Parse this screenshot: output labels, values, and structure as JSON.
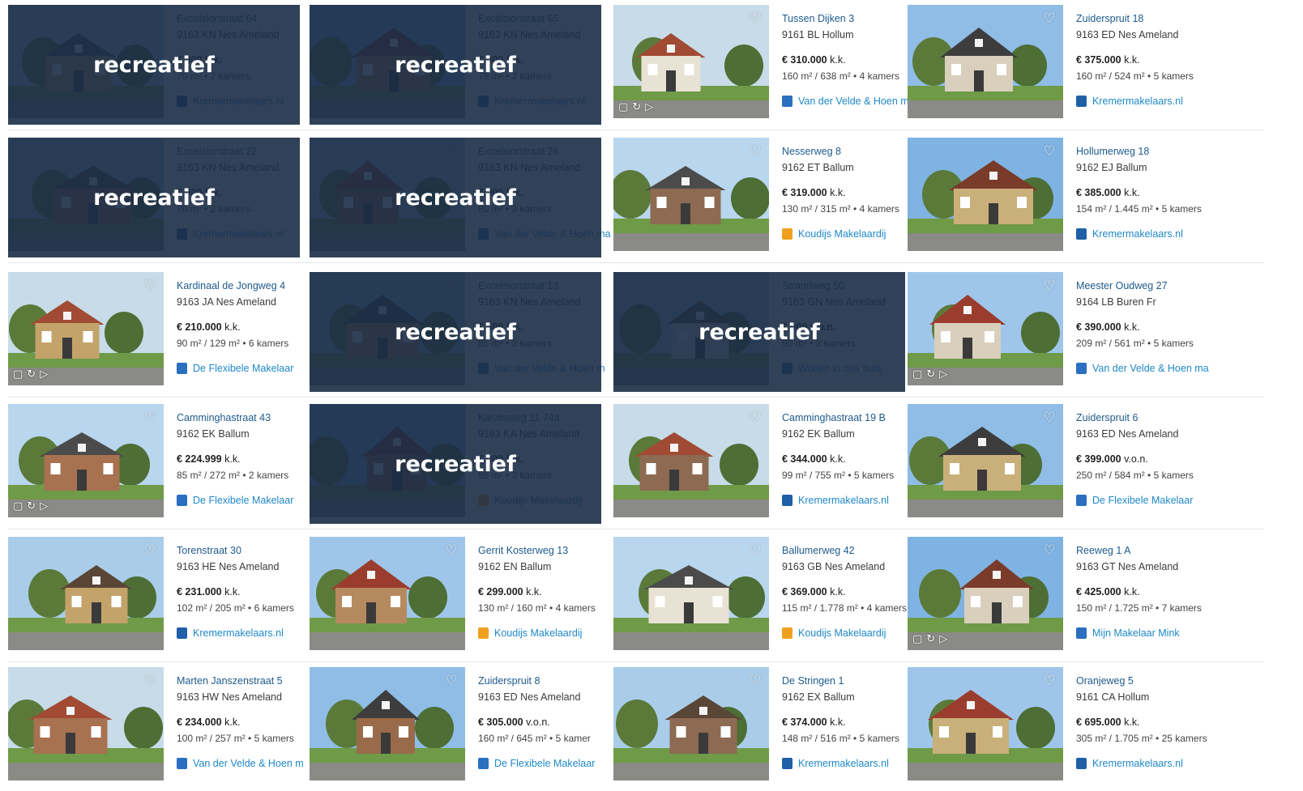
{
  "overlay_label": "recreatief",
  "colors": {
    "link": "#1e5a8c",
    "broker": "#1e88c8",
    "overlay": "#1b2c46"
  },
  "rows": [
    [
      {
        "street": "Excelsiorstraat 64",
        "city": "9163 KN Nes Ameland",
        "price": "€ 000 k.k.",
        "specs": "70 m² • 2 kamers",
        "broker": "Kremermakelaars.nl",
        "logo": "kremer",
        "overlay": true
      },
      {
        "street": "Excelsiorstraat 65",
        "city": "9163 KN Nes Ameland",
        "price": "€ 000 k.k.",
        "specs": "79 m² • 3 kamers",
        "broker": "Kremermakelaars.nl",
        "logo": "kremer",
        "overlay": true
      },
      {
        "street": "Tussen Dijken 3",
        "city": "9161 BL Hollum",
        "price": "€ 310.000",
        "kk": "k.k.",
        "specs": "160 m² / 638 m² • 4 kamers",
        "broker": "Van der Velde & Hoen m",
        "logo": "velde",
        "media": true
      },
      {
        "street": "Zuiderspruit 18",
        "city": "9163 ED Nes Ameland",
        "price": "€ 375.000",
        "kk": "k.k.",
        "specs": "160 m² / 524 m² • 5 kamers",
        "broker": "Kremermakelaars.nl",
        "logo": "kremer"
      }
    ],
    [
      {
        "street": "Excelsiorstraat 22",
        "city": "9163 KN Nes Ameland",
        "price": "€ 000 k.k.",
        "specs": "70 m² • 2 kamers",
        "broker": "Kremermakelaars.nl",
        "logo": "kremer",
        "overlay": true
      },
      {
        "street": "Excelsiorstraat 26",
        "city": "9163 KN Nes Ameland",
        "price": "€ 000 k.k.",
        "specs": "80 m² • 3 kamers",
        "broker": "Van der Velde & Hoen ma",
        "logo": "velde",
        "overlay": true
      },
      {
        "street": "Nesserweg 8",
        "city": "9162 ET Ballum",
        "price": "€ 319.000",
        "kk": "k.k.",
        "specs": "130 m² / 315 m² • 4 kamers",
        "broker": "Koudijs Makelaardij",
        "logo": "koudijs"
      },
      {
        "street": "Hollumerweg 18",
        "city": "9162 EJ Ballum",
        "price": "€ 385.000",
        "kk": "k.k.",
        "specs": "154 m² / 1.445 m² • 5 kamers",
        "broker": "Kremermakelaars.nl",
        "logo": "kremer"
      }
    ],
    [
      {
        "street": "Kardinaal de Jongweg 4",
        "city": "9163 JA Nes Ameland",
        "price": "€ 210.000",
        "kk": "k.k.",
        "specs": "90 m² / 129 m² • 6 kamers",
        "broker": "De Flexibele Makelaar",
        "logo": "velde",
        "media": true
      },
      {
        "street": "Excelsiorstraat 13",
        "city": "9163 KN Nes Ameland",
        "price": "€ 500 k.k.",
        "specs": "85 m² • 3 kamers",
        "broker": "Van der Velde & Hoen m",
        "logo": "velde",
        "overlay": true
      },
      {
        "street": "Strandweg 50",
        "city": "9163 GN Nes Ameland",
        "price": "€ 000 v.o.n.",
        "specs": "90 m² • 3 kamers",
        "broker": "Wonen in ons huis",
        "logo": "velde",
        "overlay": true
      },
      {
        "street": "Meester Oudweg 27",
        "city": "9164 LB Buren Fr",
        "price": "€ 390.000",
        "kk": "k.k.",
        "specs": "209 m² / 561 m² • 5 kamers",
        "broker": "Van der Velde & Hoen makelaardij o.",
        "logo": "velde",
        "media": true
      }
    ],
    [
      {
        "street": "Camminghastraat 43",
        "city": "9162 EK Ballum",
        "price": "€ 224.999",
        "kk": "k.k.",
        "specs": "85 m² / 272 m² • 2 kamers",
        "broker": "De Flexibele Makelaar",
        "logo": "velde",
        "media": true
      },
      {
        "street": "Kievitsweg 11 74a",
        "city": "9163 KA Nes Ameland",
        "price": "€ 000 k.k.",
        "specs": "85 m² • 3 kamers",
        "broker": "Koudijs Makelaardij",
        "logo": "koudijs",
        "overlay": true
      },
      {
        "street": "Camminghastraat 19 B",
        "city": "9162 EK Ballum",
        "price": "€ 344.000",
        "kk": "k.k.",
        "specs": "99 m² / 755 m² • 5 kamers",
        "broker": "Kremermakelaars.nl",
        "logo": "kremer"
      },
      {
        "street": "Zuiderspruit 6",
        "city": "9163 ED Nes Ameland",
        "price": "€ 399.000",
        "kk": "v.o.n.",
        "specs": "250 m² / 584 m² • 5 kamers",
        "broker": "De Flexibele Makelaar",
        "logo": "velde"
      }
    ],
    [
      {
        "street": "Torenstraat 30",
        "city": "9163 HE Nes Ameland",
        "price": "€ 231.000",
        "kk": "k.k.",
        "specs": "102 m² / 205 m² • 6 kamers",
        "broker": "Kremermakelaars.nl",
        "logo": "kremer"
      },
      {
        "street": "Gerrit Kosterweg 13",
        "city": "9162 EN Ballum",
        "price": "€ 299.000",
        "kk": "k.k.",
        "specs": "130 m² / 160 m² • 4 kamers",
        "broker": "Koudijs Makelaardij",
        "logo": "koudijs"
      },
      {
        "street": "Ballumerweg 42",
        "city": "9163 GB Nes Ameland",
        "price": "€ 369.000",
        "kk": "k.k.",
        "specs": "115 m² / 1.778 m² • 4 kamers",
        "broker": "Koudijs Makelaardij",
        "logo": "koudijs"
      },
      {
        "street": "Reeweg 1 A",
        "city": "9163 GT Nes Ameland",
        "price": "€ 425.000",
        "kk": "k.k.",
        "specs": "150 m² / 1.725 m² • 7 kamers",
        "broker": "Mijn Makelaar Mink",
        "logo": "velde",
        "media": true
      }
    ],
    [
      {
        "street": "Marten Janszenstraat 5",
        "city": "9163 HW Nes Ameland",
        "price": "€ 234.000",
        "kk": "k.k.",
        "specs": "100 m² / 257 m² • 5 kamers",
        "broker": "Van der Velde & Hoen m",
        "logo": "velde"
      },
      {
        "street": "Zuiderspruit 8",
        "city": "9163 ED Nes Ameland",
        "price": "€ 305.000",
        "kk": "v.o.n.",
        "specs": "160 m² / 645 m² • 5 kamer",
        "broker": "De Flexibele Makelaar",
        "logo": "velde"
      },
      {
        "street": "De Stringen 1",
        "city": "9162 EX Ballum",
        "price": "€ 374.000",
        "kk": "k.k.",
        "specs": "148 m² / 516 m² • 5 kamers",
        "broker": "Kremermakelaars.nl",
        "logo": "kremer"
      },
      {
        "street": "Oranjeweg 5",
        "city": "9161 CA Hollum",
        "price": "€ 695.000",
        "kk": "k.k.",
        "specs": "305 m² / 1.705 m² • 25 kamers",
        "broker": "Kremermakelaars.nl",
        "logo": "kremer"
      }
    ]
  ]
}
